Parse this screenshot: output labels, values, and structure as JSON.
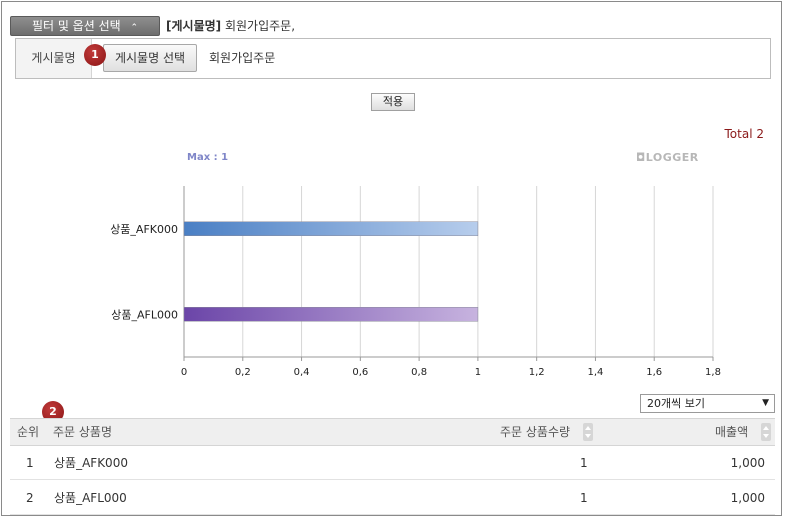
{
  "filter": {
    "toggle_label": "필터 및 옵션 선택",
    "toggle_icon": "chevron-up-icon",
    "crumb_key": "[게시물명]",
    "crumb_value": "회원가입주문,",
    "field_label": "게시물명",
    "select_button": "게시물명 선택",
    "selected_value": "회원가입주문",
    "apply_label": "적용"
  },
  "badges": [
    "1",
    "2"
  ],
  "chart_info": {
    "total": "Total 2",
    "max": "Max : 1",
    "brand": "◘LOGGER"
  },
  "chart_data": {
    "type": "bar",
    "orientation": "horizontal",
    "categories": [
      "상품_AFK000",
      "상품_AFL000"
    ],
    "values": [
      1,
      1
    ],
    "xlim": [
      0,
      1.8
    ],
    "xticks": [
      "0",
      "0,2",
      "0,4",
      "0,6",
      "0,8",
      "1",
      "1,2",
      "1,4",
      "1,6",
      "1,8"
    ],
    "grid": true,
    "colors": [
      [
        "#4a7fc4",
        "#b7cdec"
      ],
      [
        "#6b45a8",
        "#c7b3df"
      ]
    ]
  },
  "page_size": {
    "label": "20개씩 보기"
  },
  "table": {
    "headers": {
      "rank": "순위",
      "product": "주문 상품명",
      "qty": "주문 상품수량",
      "sales": "매출액"
    },
    "rows": [
      {
        "rank": "1",
        "product": "상품_AFK000",
        "qty": "1",
        "sales": "1,000"
      },
      {
        "rank": "2",
        "product": "상품_AFL000",
        "qty": "1",
        "sales": "1,000"
      }
    ]
  }
}
